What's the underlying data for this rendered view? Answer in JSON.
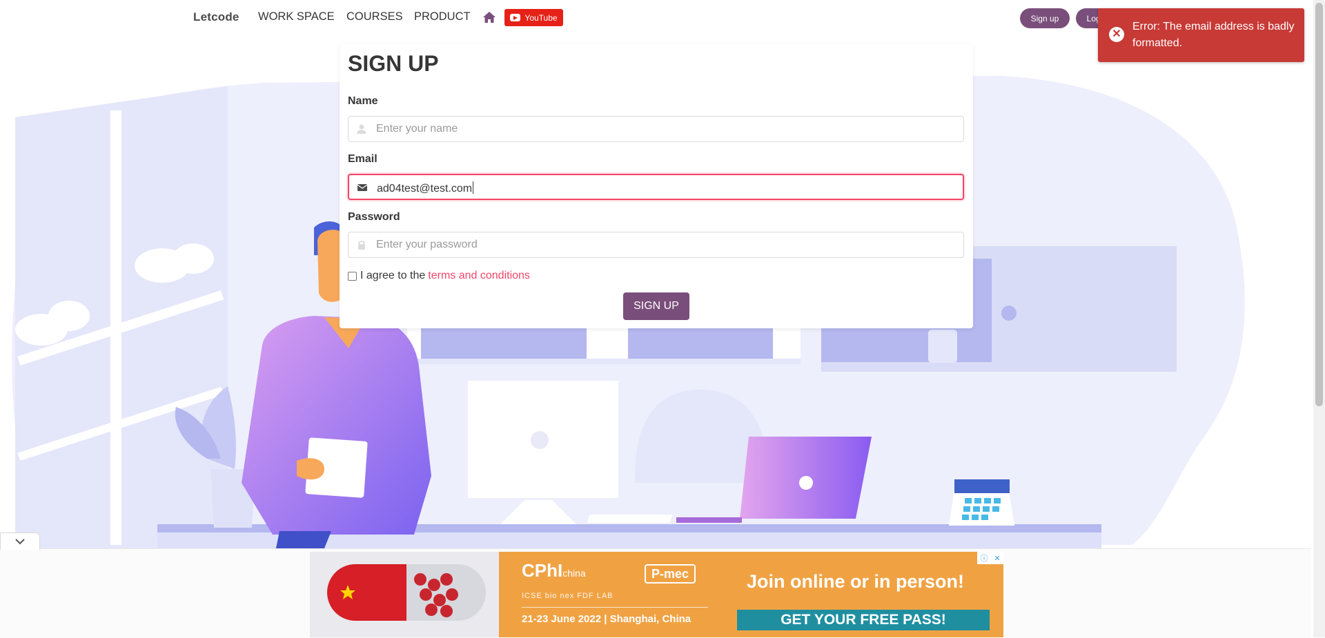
{
  "nav": {
    "brand": "Letcode",
    "items": [
      "WORK SPACE",
      "COURSES",
      "PRODUCT"
    ],
    "youtube_label": "YouTube",
    "signup_label": "Sign up",
    "login_label": "Log in"
  },
  "toast": {
    "message": "Error: The email address is badly formatted.",
    "color": "#c73a36"
  },
  "form": {
    "title": "SIGN UP",
    "name_label": "Name",
    "name_placeholder": "Enter your name",
    "email_label": "Email",
    "email_value": "ad04test@test.com",
    "password_label": "Password",
    "password_placeholder": "Enter your password",
    "terms_prefix": "I agree to the",
    "terms_link": "terms and conditions",
    "submit_label": "SIGN UP",
    "accent_color": "#7a4e7a",
    "danger_color": "#f14668"
  },
  "ad": {
    "brand": "CPhI",
    "brand_suffix": "china",
    "partner": "P-mec",
    "logos": "ICSE bio nex FDF LAB",
    "dates": "21-23 June 2022  |  Shanghai, China",
    "headline": "Join online or in person!",
    "cta": "GET YOUR FREE PASS!"
  }
}
